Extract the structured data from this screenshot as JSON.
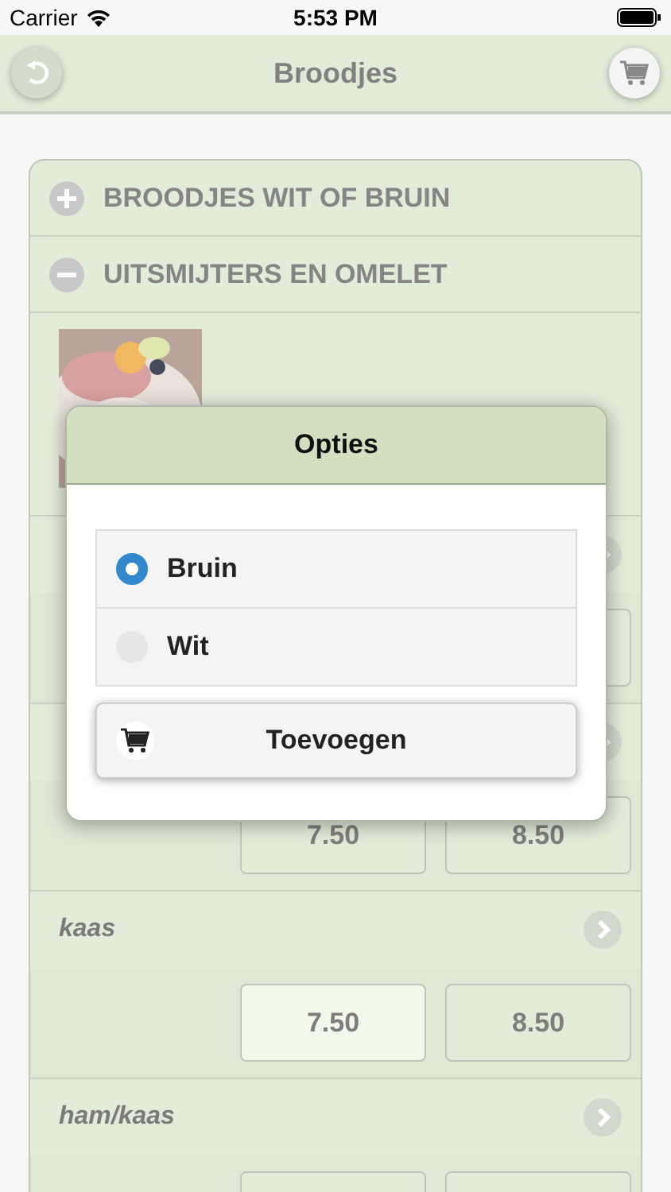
{
  "status_bar": {
    "carrier": "Carrier",
    "time": "5:53 PM"
  },
  "nav": {
    "title": "Broodjes"
  },
  "categories": [
    {
      "label": "BROODJES WIT OF BRUIN",
      "expanded": false
    },
    {
      "label": "UITSMIJTERS EN OMELET",
      "expanded": true
    }
  ],
  "products": [
    {
      "prices": [
        {
          "selected": false
        }
      ]
    },
    {
      "prices": [
        {
          "label": "7.50",
          "selected": false
        },
        {
          "label": "8.50",
          "selected": false
        }
      ]
    },
    {
      "name": "kaas",
      "prices": [
        {
          "label": "7.50",
          "selected": true
        },
        {
          "label": "8.50",
          "selected": false
        }
      ]
    },
    {
      "name": "ham/kaas",
      "prices": [
        {
          "selected": false
        },
        {
          "selected": false
        }
      ]
    }
  ],
  "dialog": {
    "title": "Opties",
    "options": [
      {
        "label": "Bruin",
        "selected": true
      },
      {
        "label": "Wit",
        "selected": false
      }
    ],
    "button": "Toevoegen"
  }
}
